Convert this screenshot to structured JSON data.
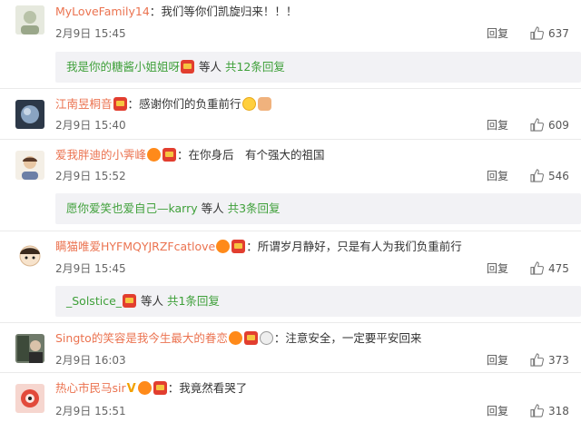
{
  "reply_label": "回复",
  "comments": [
    {
      "user": "MyLoveFamily14",
      "sep": "：",
      "text": "我们等你们凯旋归来！！！",
      "date": "2月9日 15:45",
      "likes": "637"
    },
    {
      "user": "江南昱桐音",
      "sep": "：",
      "text": "感谢你们的负重前行",
      "date": "2月9日 15:40",
      "likes": "609"
    },
    {
      "user": "爱我胖迪的小霁峰",
      "sep": "：",
      "text": "在你身后　有个强大的祖国",
      "date": "2月9日 15:52",
      "likes": "546"
    },
    {
      "user": "瞒猫唯爱HYFMQYJRZFcatlove",
      "sep": "：",
      "text": "所谓岁月静好，只是有人为我们负重前行",
      "date": "2月9日 15:45",
      "likes": "475"
    },
    {
      "user": "Singto的笑容是我今生最大的眷恋",
      "sep": "：",
      "text": "注意安全，一定要平安回来",
      "date": "2月9日 16:03",
      "likes": "373"
    },
    {
      "user": "热心市民马sir",
      "sep": "：",
      "text": "我竟然看哭了",
      "date": "2月9日 15:51",
      "likes": "318"
    }
  ],
  "replies": [
    {
      "user": "我是你的糖酱小姐姐呀",
      "suffix": " 等人",
      "count": "共12条回复"
    },
    {
      "user": "愿你爱笑也爱自己—karry",
      "suffix": " 等人",
      "count": "共3条回复"
    },
    {
      "user": "_Solstice_",
      "suffix": " 等人",
      "count": "共1条回复"
    }
  ],
  "icons": {
    "brand_red": "#e23e2f",
    "username_color": "#eb7350",
    "reply_link_color": "#3fa03a"
  }
}
